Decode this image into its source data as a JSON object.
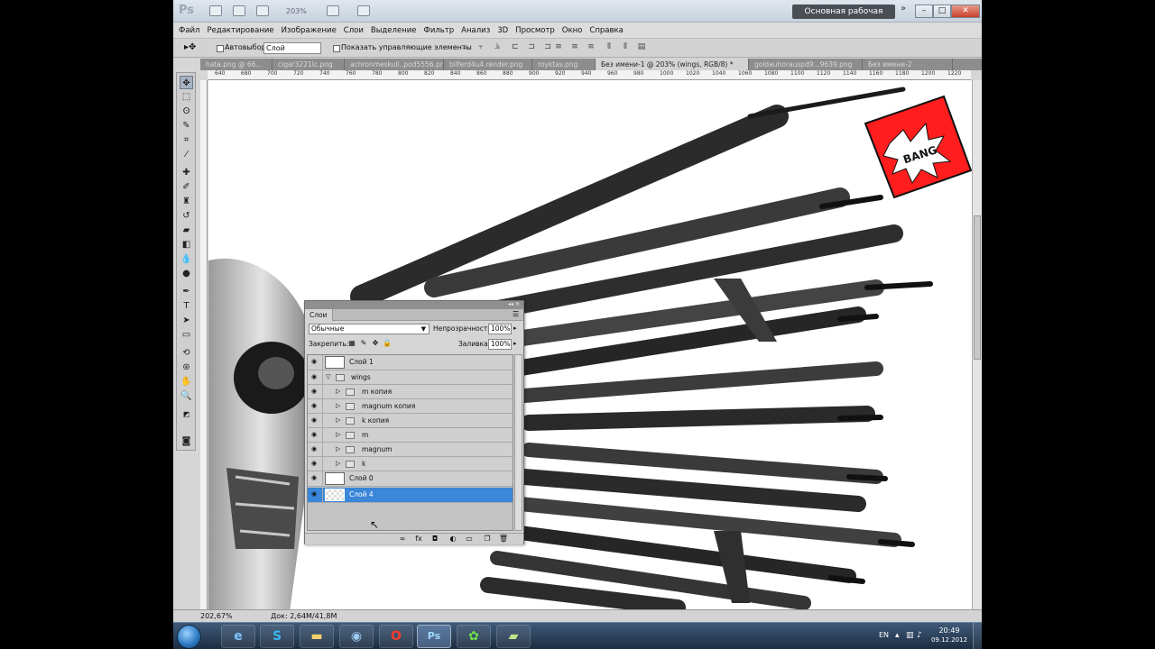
{
  "app": {
    "logo": "Ps",
    "zoom": "203%",
    "workspace": "Основная рабочая среда",
    "extend": "»",
    "win_min": "–",
    "win_max": "□",
    "win_close": "✕"
  },
  "menu": [
    "Файл",
    "Редактирование",
    "Изображение",
    "Слои",
    "Выделение",
    "Фильтр",
    "Анализ",
    "3D",
    "Просмотр",
    "Окно",
    "Справка"
  ],
  "options": {
    "autoselect_label": "Автовыбор:",
    "autoselect_value": "Слой",
    "show_controls_label": "Показать управляющие элементы"
  },
  "tabs": [
    {
      "label": "hata.png @ 66..."
    },
    {
      "label": "cigar3221lc.png"
    },
    {
      "label": "achronmeskull..pod5556.png"
    },
    {
      "label": "bilferd4u4.render.png"
    },
    {
      "label": "royktas.png"
    },
    {
      "label": "Без имени-1 @ 203% (wings, RGB/8) *",
      "active": true
    },
    {
      "label": "goldauhorauspd9...9639.png"
    },
    {
      "label": "Без имени-2"
    }
  ],
  "ruler": [
    "640",
    "680",
    "700",
    "720",
    "740",
    "760",
    "780",
    "800",
    "820",
    "840",
    "860",
    "880",
    "900",
    "920",
    "940",
    "960",
    "980",
    "1000",
    "1020",
    "1040",
    "1060",
    "1080",
    "1100",
    "1120",
    "1140",
    "1160",
    "1180",
    "1200",
    "1220"
  ],
  "status": {
    "zoom": "202,67%",
    "doc": "Док: 2,64M/41,8M"
  },
  "layers_panel": {
    "tab": "Слои",
    "blend_mode": "Обычные",
    "opacity_label": "Непрозрачность:",
    "opacity_value": "100%",
    "lock_label": "Закрепить:",
    "fill_label": "Заливка:",
    "fill_value": "100%",
    "layers": [
      {
        "name": "Слой 1",
        "kind": "layer"
      },
      {
        "name": "wings",
        "kind": "group-open"
      },
      {
        "name": "m копия",
        "kind": "group-child"
      },
      {
        "name": "magnum копия",
        "kind": "group-child"
      },
      {
        "name": "k копия",
        "kind": "group-child"
      },
      {
        "name": "m",
        "kind": "group-child"
      },
      {
        "name": "magnum",
        "kind": "group-child"
      },
      {
        "name": "k",
        "kind": "group-child"
      },
      {
        "name": "Слой 0",
        "kind": "layer"
      },
      {
        "name": "Слой 4",
        "kind": "layer",
        "selected": true
      }
    ]
  },
  "artwork": {
    "flag_text": "BANG",
    "flag_color": "#ff1d1d"
  },
  "taskbar": {
    "lang": "EN",
    "time": "20:49",
    "date": "09.12.2012"
  }
}
